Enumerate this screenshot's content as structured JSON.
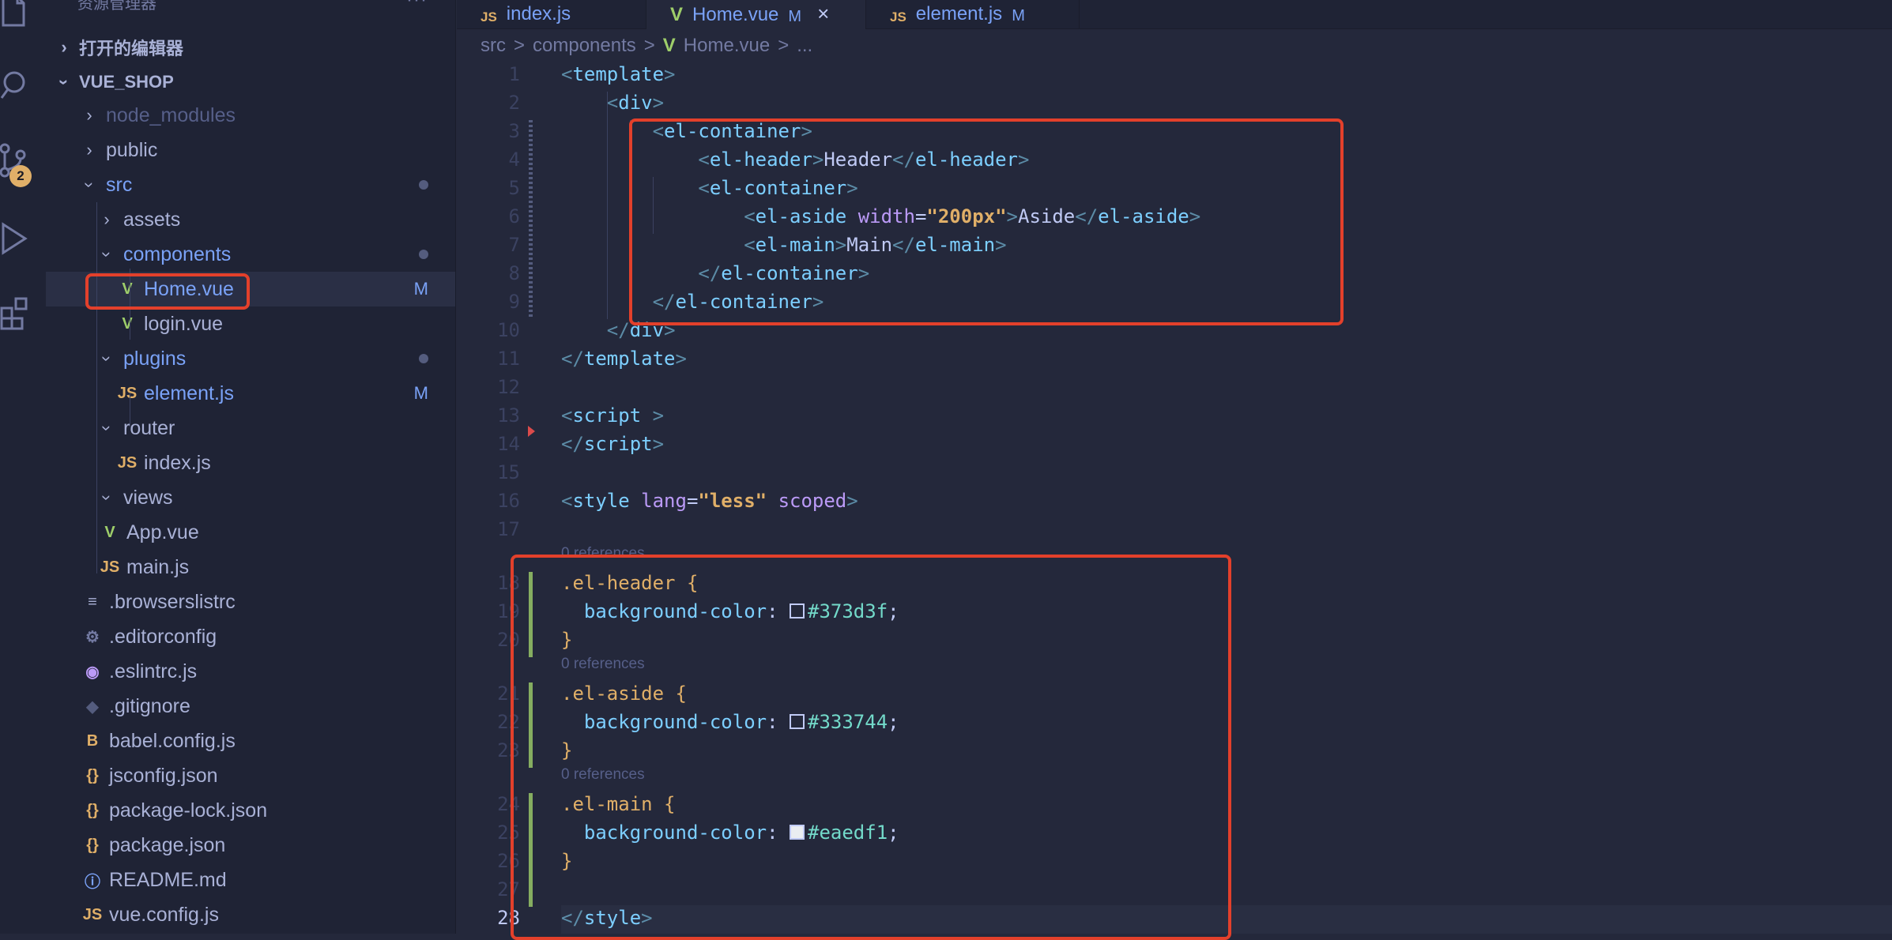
{
  "activity_bar": {
    "icons": [
      "files-icon",
      "search-icon",
      "source-control-icon",
      "run-debug-icon",
      "extensions-icon"
    ],
    "scm_badge": "2"
  },
  "sidebar": {
    "title": "资源管理器",
    "more": "···",
    "sections": {
      "open_editors": "打开的编辑器",
      "project": "VUE_SHOP"
    },
    "tree": [
      {
        "label": "node_modules",
        "kind": "folder",
        "expanded": false,
        "color": "#565f89"
      },
      {
        "label": "public",
        "kind": "folder",
        "expanded": false
      },
      {
        "label": "src",
        "kind": "folder",
        "expanded": true,
        "dot": true
      },
      {
        "label": "assets",
        "kind": "folder",
        "expanded": false
      },
      {
        "label": "components",
        "kind": "folder",
        "expanded": true,
        "dot": true
      },
      {
        "label": "Home.vue",
        "kind": "vue",
        "status": "M",
        "active": true
      },
      {
        "label": "login.vue",
        "kind": "vue"
      },
      {
        "label": "plugins",
        "kind": "folder",
        "expanded": true,
        "dot": true
      },
      {
        "label": "element.js",
        "kind": "js",
        "status": "M"
      },
      {
        "label": "router",
        "kind": "folder",
        "expanded": true
      },
      {
        "label": "index.js",
        "kind": "js"
      },
      {
        "label": "views",
        "kind": "folder",
        "expanded": true
      },
      {
        "label": "App.vue",
        "kind": "vue"
      },
      {
        "label": "main.js",
        "kind": "js"
      },
      {
        "label": ".browserslistrc",
        "kind": "list"
      },
      {
        "label": ".editorconfig",
        "kind": "gear"
      },
      {
        "label": ".eslintrc.js",
        "kind": "eslint"
      },
      {
        "label": ".gitignore",
        "kind": "git"
      },
      {
        "label": "babel.config.js",
        "kind": "babel"
      },
      {
        "label": "jsconfig.json",
        "kind": "json"
      },
      {
        "label": "package-lock.json",
        "kind": "json"
      },
      {
        "label": "package.json",
        "kind": "json"
      },
      {
        "label": "README.md",
        "kind": "info"
      },
      {
        "label": "vue.config.js",
        "kind": "js"
      }
    ]
  },
  "tabs": [
    {
      "label": "index.js",
      "icon": "JS",
      "modified": ""
    },
    {
      "label": "Home.vue",
      "icon": "V",
      "modified": "M",
      "active": true,
      "close": "×"
    },
    {
      "label": "element.js",
      "icon": "JS",
      "modified": "M"
    }
  ],
  "breadcrumb": {
    "parts": [
      "src",
      "components",
      "Home.vue",
      "..."
    ],
    "sep": ">"
  },
  "editor": {
    "references": "0 references",
    "lines": [
      [
        [
          "br",
          "<"
        ],
        [
          "tag",
          "template"
        ],
        [
          "br",
          ">"
        ]
      ],
      [
        [
          "ind",
          "    "
        ],
        [
          "br",
          "<"
        ],
        [
          "tag",
          "div"
        ],
        [
          "br",
          ">"
        ]
      ],
      [
        [
          "ind",
          "        "
        ],
        [
          "br",
          "<"
        ],
        [
          "tag",
          "el-container"
        ],
        [
          "br",
          ">"
        ]
      ],
      [
        [
          "ind",
          "            "
        ],
        [
          "br",
          "<"
        ],
        [
          "tag",
          "el-header"
        ],
        [
          "br",
          ">"
        ],
        [
          "txt",
          "Header"
        ],
        [
          "br",
          "</"
        ],
        [
          "tag",
          "el-header"
        ],
        [
          "br",
          ">"
        ]
      ],
      [
        [
          "ind",
          "            "
        ],
        [
          "br",
          "<"
        ],
        [
          "tag",
          "el-container"
        ],
        [
          "br",
          ">"
        ]
      ],
      [
        [
          "ind",
          "                "
        ],
        [
          "br",
          "<"
        ],
        [
          "tag",
          "el-aside"
        ],
        [
          "txt",
          " "
        ],
        [
          "attr",
          "width"
        ],
        [
          "txt",
          "="
        ],
        [
          "str",
          "\"200px\""
        ],
        [
          "br",
          ">"
        ],
        [
          "txt",
          "Aside"
        ],
        [
          "br",
          "</"
        ],
        [
          "tag",
          "el-aside"
        ],
        [
          "br",
          ">"
        ]
      ],
      [
        [
          "ind",
          "                "
        ],
        [
          "br",
          "<"
        ],
        [
          "tag",
          "el-main"
        ],
        [
          "br",
          ">"
        ],
        [
          "txt",
          "Main"
        ],
        [
          "br",
          "</"
        ],
        [
          "tag",
          "el-main"
        ],
        [
          "br",
          ">"
        ]
      ],
      [
        [
          "ind",
          "            "
        ],
        [
          "br",
          "</"
        ],
        [
          "tag",
          "el-container"
        ],
        [
          "br",
          ">"
        ]
      ],
      [
        [
          "ind",
          "        "
        ],
        [
          "br",
          "</"
        ],
        [
          "tag",
          "el-container"
        ],
        [
          "br",
          ">"
        ]
      ],
      [
        [
          "ind",
          "    "
        ],
        [
          "br",
          "</"
        ],
        [
          "tag",
          "div"
        ],
        [
          "br",
          ">"
        ]
      ],
      [
        [
          "br",
          "</"
        ],
        [
          "tag",
          "template"
        ],
        [
          "br",
          ">"
        ]
      ],
      [],
      [
        [
          "br",
          "<"
        ],
        [
          "tag",
          "script"
        ],
        [
          "txt",
          " "
        ],
        [
          "br",
          ">"
        ]
      ],
      [
        [
          "br",
          "</"
        ],
        [
          "tag",
          "script"
        ],
        [
          "br",
          ">"
        ]
      ],
      [],
      [
        [
          "br",
          "<"
        ],
        [
          "tag",
          "style"
        ],
        [
          "txt",
          " "
        ],
        [
          "attr",
          "lang"
        ],
        [
          "txt",
          "="
        ],
        [
          "str",
          "\"less\""
        ],
        [
          "txt",
          " "
        ],
        [
          "attr",
          "scoped"
        ],
        [
          "br",
          ">"
        ]
      ],
      [],
      [
        [
          "sel",
          ".el-header {"
        ]
      ],
      [
        [
          "ind",
          "  "
        ],
        [
          "prop",
          "background-color"
        ],
        [
          "txt",
          ": "
        ],
        [
          "swatch",
          "#373d3f"
        ],
        [
          "val",
          "#373d3f"
        ],
        [
          "txt",
          ";"
        ]
      ],
      [
        [
          "sel",
          "}"
        ]
      ],
      [
        [
          "sel",
          ".el-aside {"
        ]
      ],
      [
        [
          "ind",
          "  "
        ],
        [
          "prop",
          "background-color"
        ],
        [
          "txt",
          ": "
        ],
        [
          "swatch",
          "#333744"
        ],
        [
          "val",
          "#333744"
        ],
        [
          "txt",
          ";"
        ]
      ],
      [
        [
          "sel",
          "}"
        ]
      ],
      [
        [
          "sel",
          ".el-main {"
        ]
      ],
      [
        [
          "ind",
          "  "
        ],
        [
          "prop",
          "background-color"
        ],
        [
          "txt",
          ": "
        ],
        [
          "swatch",
          "#eaedf1"
        ],
        [
          "val",
          "#eaedf1"
        ],
        [
          "txt",
          ";"
        ]
      ],
      [
        [
          "sel",
          "}"
        ]
      ],
      [],
      [
        [
          "br",
          "</"
        ],
        [
          "tag",
          "style"
        ],
        [
          "br",
          ">"
        ]
      ]
    ]
  },
  "colors": {
    "highlight_box": "#e3402b",
    "editor_bg": "#24283b",
    "sidebar_bg": "#1f2335"
  }
}
